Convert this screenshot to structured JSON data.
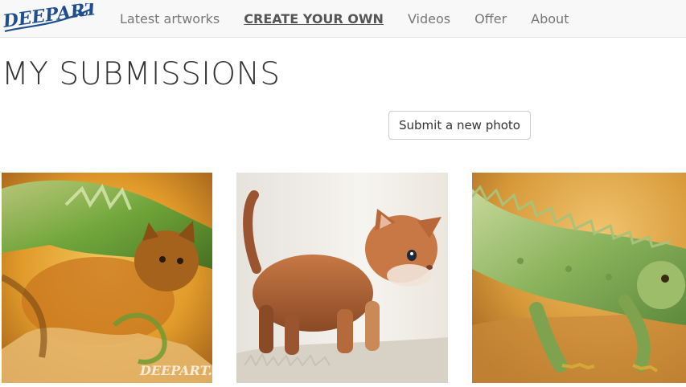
{
  "brand": {
    "logo_text": "DEEPART",
    "logo_suffix": ".io"
  },
  "nav": {
    "items": [
      {
        "label": "Latest artworks"
      },
      {
        "label": "CREATE YOUR OWN",
        "active": true
      },
      {
        "label": "Videos"
      },
      {
        "label": "Offer"
      },
      {
        "label": "About"
      }
    ]
  },
  "page": {
    "title": "MY SUBMISSIONS"
  },
  "actions": {
    "submit_label": "Submit a new photo"
  },
  "gallery": {
    "items": [
      {
        "subject": "stylized kitten and iguana artwork",
        "watermark": "DEEPART.io"
      },
      {
        "subject": "kitten photo"
      },
      {
        "subject": "iguana photo"
      }
    ]
  },
  "colors": {
    "navbar_bg": "#f8f8f8",
    "logo_blue": "#1f4f8f",
    "nav_text": "#777777",
    "title_text": "#333333"
  }
}
